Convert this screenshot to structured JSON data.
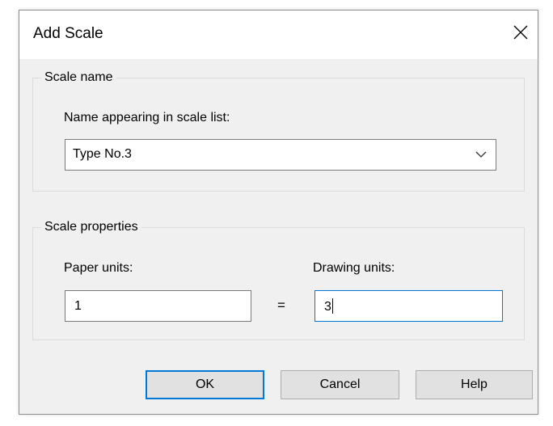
{
  "dialog": {
    "title": "Add Scale",
    "close_icon": "close-icon"
  },
  "scale_name_group": {
    "legend": "Scale name",
    "field_label": "Name appearing in scale list:",
    "selected_value": "Type No.3",
    "dropdown_icon": "chevron-down-icon"
  },
  "scale_properties_group": {
    "legend": "Scale properties",
    "paper_units_label": "Paper units:",
    "paper_units_value": "1",
    "equals_sign": "=",
    "drawing_units_label": "Drawing units:",
    "drawing_units_value": "3"
  },
  "buttons": {
    "ok": "OK",
    "cancel": "Cancel",
    "help": "Help"
  },
  "colors": {
    "dialog_bg": "#f0f0f0",
    "titlebar_bg": "#ffffff",
    "focus_accent": "#0078d7",
    "button_bg": "#e1e1e1"
  }
}
